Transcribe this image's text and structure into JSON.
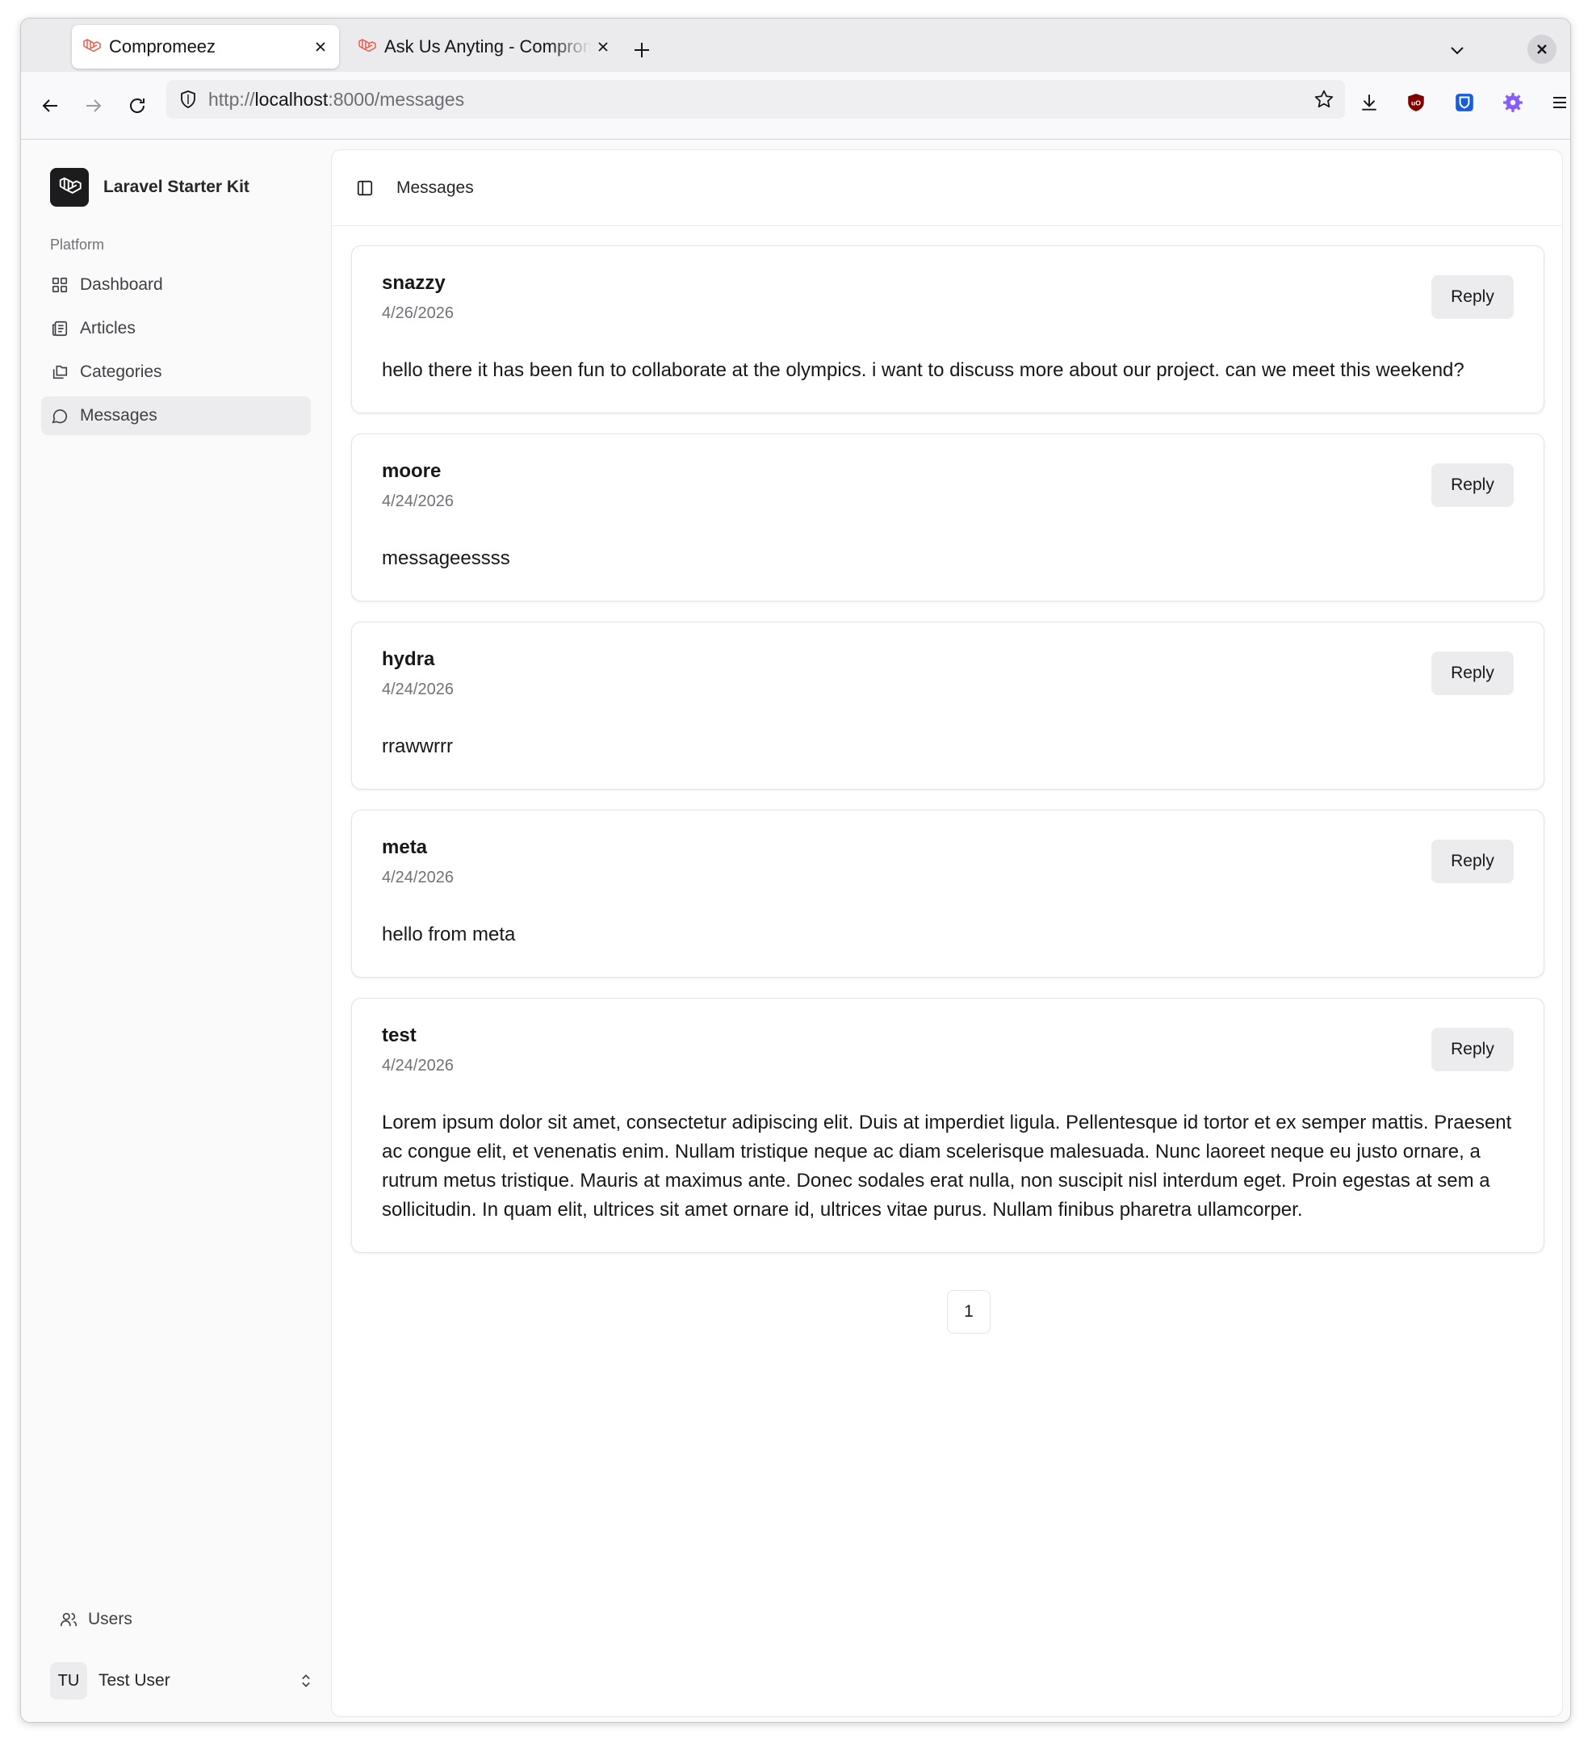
{
  "browser": {
    "tabs": [
      {
        "label": "Compromeez",
        "active": true
      },
      {
        "label": "Ask Us Anyting - Compromeez",
        "active": false
      }
    ],
    "url": {
      "scheme": "http://",
      "host": "localhost",
      "rest": ":8000/messages"
    }
  },
  "sidebar": {
    "brand": "Laravel Starter Kit",
    "section": "Platform",
    "items": [
      {
        "label": "Dashboard",
        "icon": "dashboard-grid-icon"
      },
      {
        "label": "Articles",
        "icon": "newspaper-icon"
      },
      {
        "label": "Categories",
        "icon": "folders-icon"
      },
      {
        "label": "Messages",
        "icon": "message-circle-icon",
        "active": true
      }
    ],
    "footer_link": "Users",
    "user": {
      "initials": "TU",
      "name": "Test User"
    }
  },
  "header": {
    "title": "Messages"
  },
  "messages": [
    {
      "sender": "snazzy",
      "date": "4/26/2026",
      "body": "hello there it has been fun to collaborate at the olympics. i want to discuss more about our project. can we meet this weekend?",
      "action": "Reply"
    },
    {
      "sender": "moore",
      "date": "4/24/2026",
      "body": "messageessss",
      "action": "Reply"
    },
    {
      "sender": "hydra",
      "date": "4/24/2026",
      "body": "rrawwrrr",
      "action": "Reply"
    },
    {
      "sender": "meta",
      "date": "4/24/2026",
      "body": "hello from meta",
      "action": "Reply"
    },
    {
      "sender": "test",
      "date": "4/24/2026",
      "body": "Lorem ipsum dolor sit amet, consectetur adipiscing elit. Duis at imperdiet ligula. Pellentesque id tortor et ex semper mattis. Praesent ac congue elit, et venenatis enim. Nullam tristique neque ac diam scelerisque malesuada. Nunc laoreet neque eu justo ornare, a rutrum metus tristique. Mauris at maximus ante. Donec sodales erat nulla, non suscipit nisl interdum eget. Proin egestas at sem a sollicitudin. In quam elit, ultrices sit amet ornare id, ultrices vitae purus. Nullam finibus pharetra ullamcorper.",
      "action": "Reply"
    }
  ],
  "pagination": {
    "current": "1"
  },
  "colors": {
    "laravel_red": "#f53003",
    "ublock_red": "#800000",
    "bitwarden_blue": "#175ddc",
    "extension_purple": "#8a5cf6"
  }
}
